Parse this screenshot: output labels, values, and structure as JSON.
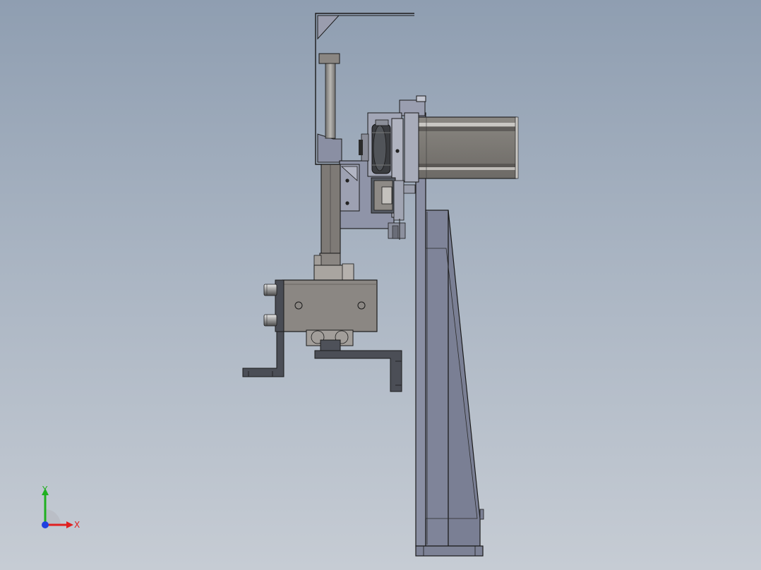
{
  "viewport": {
    "background_top": "#8f9eb1",
    "background_bottom": "#c6ccd4"
  },
  "triad": {
    "x_label": "X",
    "y_label": "Y",
    "x_color": "#e02020",
    "y_color": "#20b020",
    "z_color": "#2040e0"
  }
}
